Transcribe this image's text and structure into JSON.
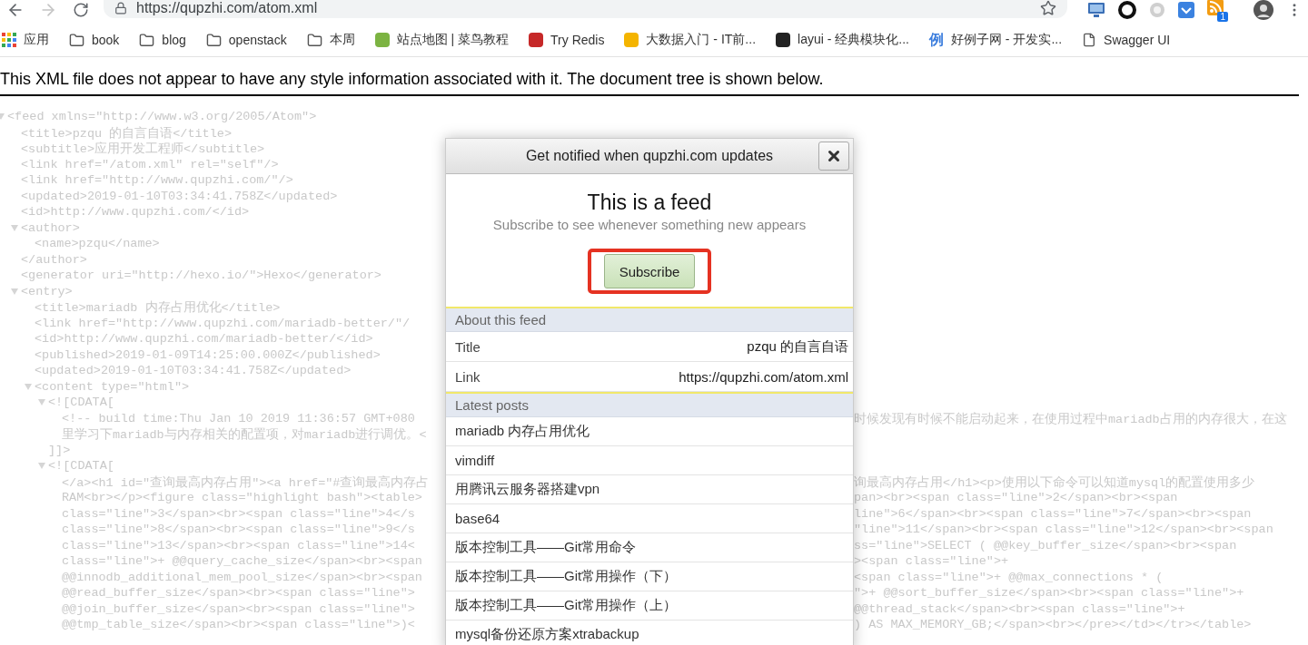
{
  "toolbar": {
    "back_disabled": false,
    "forward_disabled": true,
    "url": "https://qupzhi.com/atom.xml",
    "starred": false,
    "extensions": [
      {
        "kind": "monitor"
      },
      {
        "kind": "ring"
      },
      {
        "kind": "dot"
      },
      {
        "kind": "pocket"
      },
      {
        "kind": "rss",
        "badge": "1"
      },
      {
        "kind": "avatar"
      }
    ]
  },
  "bookmarks": [
    {
      "kind": "apps",
      "label": "应用"
    },
    {
      "kind": "folder",
      "label": "book"
    },
    {
      "kind": "folder",
      "label": "blog"
    },
    {
      "kind": "folder",
      "label": "openstack"
    },
    {
      "kind": "folder",
      "label": "本周"
    },
    {
      "kind": "site",
      "label": "站点地图 | 菜鸟教程",
      "color": "#7cb342"
    },
    {
      "kind": "site",
      "label": "Try Redis",
      "color": "#c62828"
    },
    {
      "kind": "site",
      "label": "大数据入门 - IT前...",
      "color": "#f4b400"
    },
    {
      "kind": "site",
      "label": "layui - 经典模块化...",
      "color": "#222222"
    },
    {
      "kind": "glyph",
      "glyph": "例",
      "label": "好例子网 - 开发实..."
    },
    {
      "kind": "page",
      "label": "Swagger UI"
    }
  ],
  "notice": "This XML file does not appear to have any style information associated with it. The document tree is shown below.",
  "xml_tree": [
    {
      "text": "<feed xmlns=\"http://www.w3.org/2005/Atom\">",
      "expanded": true,
      "children": [
        {
          "text": "<title>pzqu 的自言自语</title>"
        },
        {
          "text": "<subtitle>应用开发工程师</subtitle>"
        },
        {
          "text": "<link href=\"/atom.xml\" rel=\"self\"/>"
        },
        {
          "text": "<link href=\"http://www.qupzhi.com/\"/>"
        },
        {
          "text": "<updated>2019-01-10T03:34:41.758Z</updated>"
        },
        {
          "text": "<id>http://www.qupzhi.com/</id>"
        },
        {
          "text": "<author>",
          "expanded": true,
          "close": "</author>",
          "children": [
            {
              "text": "<name>pzqu</name>"
            }
          ]
        },
        {
          "text": "<generator uri=\"http://hexo.io/\">Hexo</generator>"
        },
        {
          "text": "<entry>",
          "expanded": true,
          "children": [
            {
              "text": "<title>mariadb 内存占用优化</title>"
            },
            {
              "text": "<link href=\"http://www.qupzhi.com/mariadb-better/\"/"
            },
            {
              "text": "<id>http://www.qupzhi.com/mariadb-better/</id>"
            },
            {
              "text": "<published>2019-01-09T14:25:00.000Z</published>"
            },
            {
              "text": "<updated>2019-01-10T03:34:41.758Z</updated>"
            },
            {
              "text": "<content type=\"html\">",
              "expanded": true,
              "children": [
                {
                  "text": "<![CDATA[",
                  "expanded": true,
                  "close": "]]>",
                  "children": [
                    {
                      "text": "<!-- build time:Thu Jan 10 2019 11:36:57 GMT+080",
                      "right": "时候发现有时候不能启动起来，在使用过程中mariadb占用的内存很大，在这"
                    },
                    {
                      "text": "里学习下mariadb与内存相关的配置项，对mariadb进行调优。<"
                    }
                  ]
                },
                {
                  "text": "<![CDATA[",
                  "expanded": true,
                  "children": [
                    {
                      "text": "</a><h1 id=\"查询最高内存占用\"><a href=\"#查询最高内存占",
                      "right": "询最高内存占用</h1><p>使用以下命令可以知道mysql的配置使用多少"
                    },
                    {
                      "text": "RAM<br></p><figure class=\"highlight bash\"><table>",
                      "right": "pan><br><span class=\"line\">2</span><br><span"
                    },
                    {
                      "text": "class=\"line\">3</span><br><span class=\"line\">4</s",
                      "right": "line\">6</span><br><span class=\"line\">7</span><br><span"
                    },
                    {
                      "text": "class=\"line\">8</span><br><span class=\"line\">9</s",
                      "right": "\"line\">11</span><br><span class=\"line\">12</span><br><span"
                    },
                    {
                      "text": "class=\"line\">13</span><br><span class=\"line\">14<",
                      "right": "ss=\"line\">SELECT ( @@key_buffer_size</span><br><span"
                    },
                    {
                      "text": "class=\"line\">+ @@query_cache_size</span><br><span",
                      "right": "><span class=\"line\">+"
                    },
                    {
                      "text": "@@innodb_additional_mem_pool_size</span><br><span",
                      "right": "<span class=\"line\">+ @@max_connections * ("
                    },
                    {
                      "text": "@@read_buffer_size</span><br><span class=\"line\">",
                      "right": "\">+ @@sort_buffer_size</span><br><span class=\"line\">+"
                    },
                    {
                      "text": "@@join_buffer_size</span><br><span class=\"line\">",
                      "right": "@@thread_stack</span><br><span class=\"line\">+"
                    },
                    {
                      "text": "@@tmp_table_size</span><br><span class=\"line\">)<",
                      "right": ") AS MAX_MEMORY_GB;</span><br></pre></td></tr></table>"
                    }
                  ]
                }
              ]
            }
          ]
        }
      ]
    }
  ],
  "popup": {
    "title": "Get notified when qupzhi.com updates",
    "heading": "This is a feed",
    "subheading": "Subscribe to see whenever something new appears",
    "subscribe": {
      "label": "Subscribe",
      "highlighted": true
    },
    "sections": [
      {
        "kind": "details",
        "title": "About this feed",
        "rows": [
          {
            "label": "Title",
            "value": "pzqu 的自言自语"
          },
          {
            "label": "Link",
            "value": "https://qupzhi.com/atom.xml"
          }
        ]
      },
      {
        "kind": "posts",
        "title": "Latest posts",
        "posts": [
          "mariadb 内存占用优化",
          "vimdiff",
          "用腾讯云服务器搭建vpn",
          "base64",
          "版本控制工具——Git常用命令",
          "版本控制工具——Git常用操作（下）",
          "版本控制工具——Git常用操作（上）",
          "mysql备份还原方案xtrabackup"
        ]
      }
    ]
  }
}
